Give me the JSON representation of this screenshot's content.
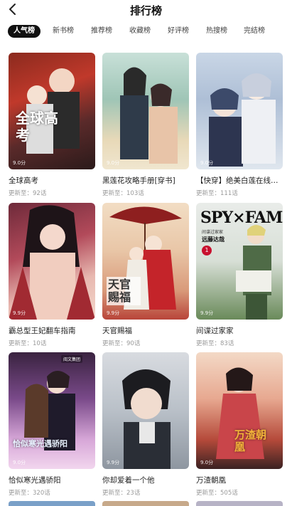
{
  "header": {
    "title": "排行榜"
  },
  "tabs": [
    "人气榜",
    "新书榜",
    "推荐榜",
    "收藏榜",
    "好评榜",
    "热搜榜",
    "完结榜"
  ],
  "active_tab_index": 0,
  "update_prefix": "更新至：",
  "books": [
    {
      "title": "全球高考",
      "update": "92话",
      "score": "9.0分",
      "cover_text": "全球高考"
    },
    {
      "title": "黑莲花攻略手册[穿书]",
      "update": "103话",
      "score": "9.0分",
      "cover_text": ""
    },
    {
      "title": "【快穿】绝美白莲在线教学",
      "update": "111话",
      "score": "9.0分",
      "cover_text": ""
    },
    {
      "title": "霸总型王妃翻车指南",
      "update": "10话",
      "score": "9.9分",
      "cover_text": ""
    },
    {
      "title": "天官赐福",
      "update": "90话",
      "score": "9.9分",
      "cover_text": "天官赐福"
    },
    {
      "title": "间谍过家家",
      "update": "83话",
      "score": "9.9分",
      "cover_text": "SPY×FAMILY",
      "cover_sub": "间谍过家家",
      "cover_author": "远藤达哉",
      "cover_badge": "1"
    },
    {
      "title": "恰似寒光遇骄阳",
      "update": "320话",
      "score": "9.0分",
      "cover_text": "恰似寒光遇骄阳",
      "cover_publisher": "阅文集团"
    },
    {
      "title": "你却爱着一个他",
      "update": "23话",
      "score": "9.9分",
      "cover_text": ""
    },
    {
      "title": "万渣朝凰",
      "update": "505话",
      "score": "9.0分",
      "cover_text": "万渣朝凰"
    }
  ],
  "colors": {
    "active_tab_bg": "#111111",
    "active_tab_text": "#ffffff",
    "muted": "#999999",
    "spy_red": "#c8102e"
  }
}
